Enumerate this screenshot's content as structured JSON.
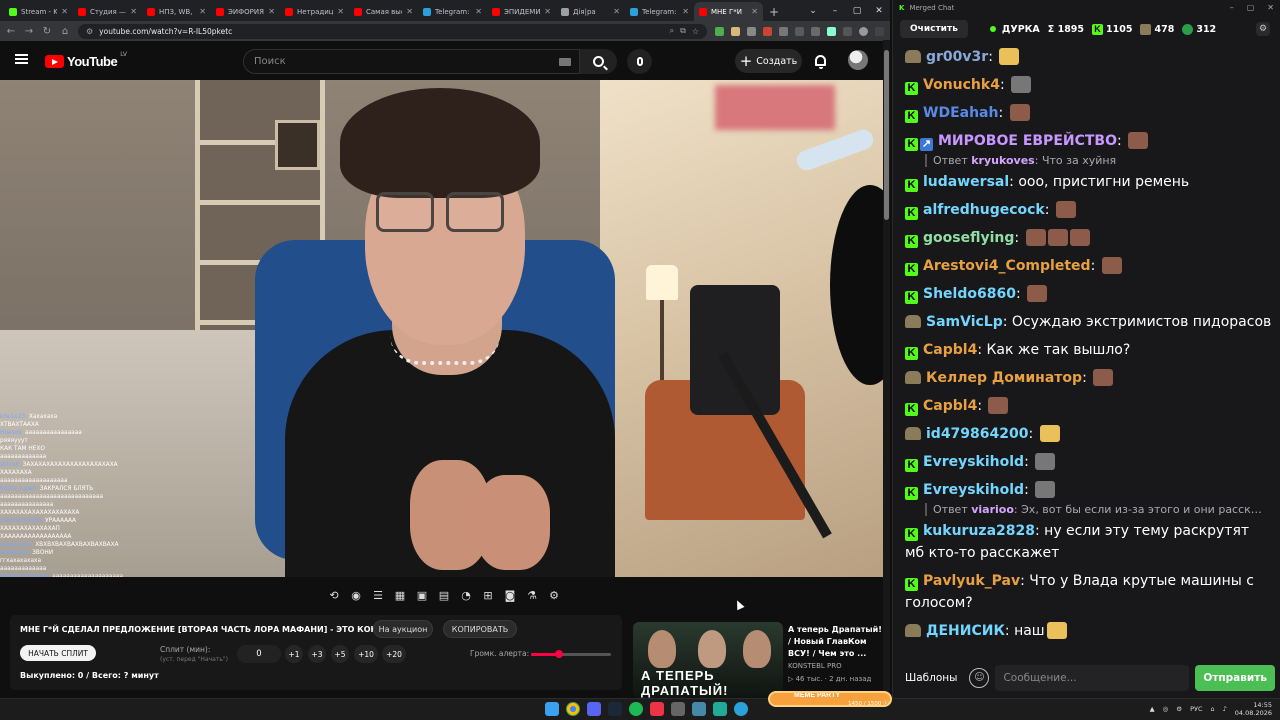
{
  "browser": {
    "tabs": [
      {
        "title": "Stream - Ki",
        "color": "#53fc18",
        "active": false
      },
      {
        "title": "Студия — Y",
        "color": "#ff0000",
        "active": false
      },
      {
        "title": "НПЗ, WB, Ч",
        "color": "#ff0000",
        "active": false
      },
      {
        "title": "ЭЙФОРИЯ",
        "color": "#ff0000",
        "active": false
      },
      {
        "title": "Нетрадици",
        "color": "#ff0000",
        "active": false
      },
      {
        "title": "Самая выс",
        "color": "#ff0000",
        "active": false
      },
      {
        "title": "Telegram: V",
        "color": "#2aa1da",
        "active": false
      },
      {
        "title": "ЭПИДЕМИ",
        "color": "#ff0000",
        "active": false
      },
      {
        "title": "Дія|ра",
        "color": "#9aa0a6",
        "active": false
      },
      {
        "title": "Telegram: V",
        "color": "#2aa1da",
        "active": false
      },
      {
        "title": "МНЕ Г*Й",
        "color": "#ff0000",
        "active": true
      }
    ],
    "url": "youtube.com/watch?v=R-IL50pketc"
  },
  "youtube": {
    "logo_text": "YouTube",
    "country_code": "LV",
    "search_placeholder": "Поиск",
    "create_label": "Создать"
  },
  "overlay_chat": [
    {
      "user": "khe1x23:",
      "text": "Хахахаха"
    },
    {
      "user": "",
      "text": "ХТВАХТААХА"
    },
    {
      "user": "Huesos:",
      "text": "аааааааааааааааа"
    },
    {
      "user": "",
      "text": "ряяяууут"
    },
    {
      "user": "",
      "text": "КАК ТАМ НЕХО"
    },
    {
      "user": "",
      "text": "ааааааааааааа"
    },
    {
      "user": "stiivok:",
      "text": "ЗАХАХАХАХАХАХАХАХАХАХАХА"
    },
    {
      "user": "",
      "text": "ХАХАХАХА"
    },
    {
      "user": "",
      "text": "ааааааааааааааааааа"
    },
    {
      "user": "Koska_lupen:",
      "text": "ЗАКРАЛСЯ БЛЯТЬ"
    },
    {
      "user": "",
      "text": "ааааааааааааааааааааааааааааа"
    },
    {
      "user": "",
      "text": "ааааааааааааааа"
    },
    {
      "user": "",
      "text": "ХАХАХАХАХАХАХАХАХАХА"
    },
    {
      "user": "maxidarkholig:",
      "text": "УРАААААА"
    },
    {
      "user": "",
      "text": "ХАХАХАХАХАХАХАП"
    },
    {
      "user": "",
      "text": "ХААААААААААААААААА"
    },
    {
      "user": "svasiary11:",
      "text": "ХВХВХВАХВАХВАХВАХВАХА"
    },
    {
      "user": "zeroboyst:",
      "text": "ЗВОНИ"
    },
    {
      "user": "",
      "text": "ггхахахахаха"
    },
    {
      "user": "",
      "text": "ааааааааааааа"
    },
    {
      "user": "darkeyhostaegle:",
      "text": "аааааааааааааааааааа"
    },
    {
      "user": "",
      "text": "ааааааааааа"
    },
    {
      "user": "",
      "text": "ХАХАХАХАХАХА"
    },
    {
      "user": "",
      "text": "ХАХХАХАХАХАХАХ"
    },
    {
      "user": "papa_46:",
      "text": "аааааааааааа"
    },
    {
      "user": "",
      "text": "аааааааа"
    }
  ],
  "panel": {
    "title": "МНЕ Г*Й СДЕЛАЛ ПРЕДЛОЖЕНИЕ [ВТОРАЯ ЧАСТЬ ЛОРА МАФАНИ] - ЭТО КОНЕЦ???",
    "auction_btn": "На аукцион",
    "copy_btn": "КОПИРОВАТЬ",
    "start_split_btn": "НАЧАТЬ СПЛИТ",
    "split_label": "Сплит (мин):",
    "split_hint": "(уст. перед \"Начать\")",
    "split_value": "0",
    "increments": [
      "+1",
      "+3",
      "+5",
      "+10",
      "+20"
    ],
    "volume_label": "Громк. алерта:",
    "volume_level": 0.35,
    "bought_text": "Выкуплено: 0 / Всего: ? минут"
  },
  "recommended": {
    "title": "А теперь Драпатый! / Новый ГлавКом ВСУ! / Чем это ...",
    "channel": "KONSTEBL PRO",
    "meta": "▷ 46 тыс. · 2 дн. назад",
    "thumb_text": "А ТЕПЕРЬ ДРАПАТЫЙ!"
  },
  "chat": {
    "window_title": "Merged Chat",
    "clear_label": "Очистить",
    "channel": "ДУРКА",
    "stat_total": "Σ 1895",
    "stat_kick": "1105",
    "stat_twitch": "478",
    "stat_other": "312",
    "messages": [
      {
        "badge": "hat",
        "user": "gr00v3r",
        "color": "#8aa8d8",
        "text": "",
        "emotes": [
          "#e9c05a"
        ]
      },
      {
        "badge": "k",
        "user": "Vonuchk4",
        "color": "#e8a040",
        "text": "",
        "emotes": [
          "#777777"
        ]
      },
      {
        "badge": "k",
        "user": "WDEahah",
        "color": "#5a8ae6",
        "text": "",
        "emotes": [
          "#8d5b4a"
        ]
      },
      {
        "badge": "k",
        "badge2": true,
        "user": "МИРОВОЕ ЕВРЕЙСТВО",
        "color": "#c897ff",
        "text": "",
        "emotes": [
          "#8d5b4a"
        ]
      },
      {
        "reply_user": "kryukoves",
        "reply_text": "Что за хуйня"
      },
      {
        "badge": "k",
        "user": "ludawersal",
        "color": "#72d6ff",
        "text": "ооо, пристигни ремень",
        "emotes": []
      },
      {
        "badge": "k",
        "user": "alfredhugecock",
        "color": "#72d6ff",
        "text": "",
        "emotes": [
          "#8d5b4a"
        ]
      },
      {
        "badge": "k",
        "user": "gooseflying",
        "color": "#8fe0a0",
        "text": "",
        "emotes": [
          "#8d5b4a",
          "#8d5b4a",
          "#8d5b4a"
        ]
      },
      {
        "badge": "k",
        "user": "Arestovi4_Completed",
        "color": "#e8a040",
        "text": "",
        "emotes": [
          "#8d5b4a"
        ]
      },
      {
        "badge": "k",
        "user": "Sheldo6860",
        "color": "#72d6ff",
        "text": "",
        "emotes": [
          "#8d5b4a"
        ]
      },
      {
        "badge": "hat",
        "user": "SamVicLp",
        "color": "#72d6ff",
        "text": "Осуждаю экстримистов пидорасов",
        "emotes": []
      },
      {
        "badge": "k",
        "user": "Capbl4",
        "color": "#e8a040",
        "text": "Как же так вышло?",
        "emotes": []
      },
      {
        "badge": "hat",
        "user": "Келлер Доминатор",
        "color": "#e8a040",
        "text": "",
        "emotes": [
          "#8d5b4a"
        ]
      },
      {
        "badge": "k",
        "user": "Capbl4",
        "color": "#e8a040",
        "text": "",
        "emotes": [
          "#8d5b4a"
        ]
      },
      {
        "badge": "hat",
        "user": "id479864200",
        "color": "#72d6ff",
        "text": "",
        "emotes": [
          "#e9c05a"
        ]
      },
      {
        "badge": "k",
        "user": "Evreyskihold",
        "color": "#72d6ff",
        "text": "",
        "emotes": [
          "#777777"
        ]
      },
      {
        "badge": "k",
        "user": "Evreyskihold",
        "color": "#72d6ff",
        "text": "",
        "emotes": [
          "#777777"
        ]
      },
      {
        "reply_user": "viarioo",
        "reply_text": "Эх, вот бы если из-за этого и они расска..."
      },
      {
        "badge": "k",
        "user": "kukuruza2828",
        "color": "#72d6ff",
        "text": "ну если эту тему раскрутят мб кто-то расскажет",
        "emotes": []
      },
      {
        "badge": "k",
        "user": "Pavlyuk_Pav",
        "color": "#e8a040",
        "text": "Что у Влада крутые машины с голосом?",
        "emotes": []
      },
      {
        "badge": "hat",
        "user": "ДЕНИСИК",
        "color": "#72d6ff",
        "text": "наш",
        "emotes": [
          "#e9c05a"
        ]
      }
    ],
    "templates_label": "Шаблоны",
    "input_placeholder": "Сообщение...",
    "send_label": "Отправить"
  },
  "taskbar": {
    "lang": "РУС",
    "time": "14:55",
    "date": "04.08.2026",
    "kick_widget": "MEME PARTY",
    "kick_progress": "1450 / 1500 ⓔ"
  }
}
